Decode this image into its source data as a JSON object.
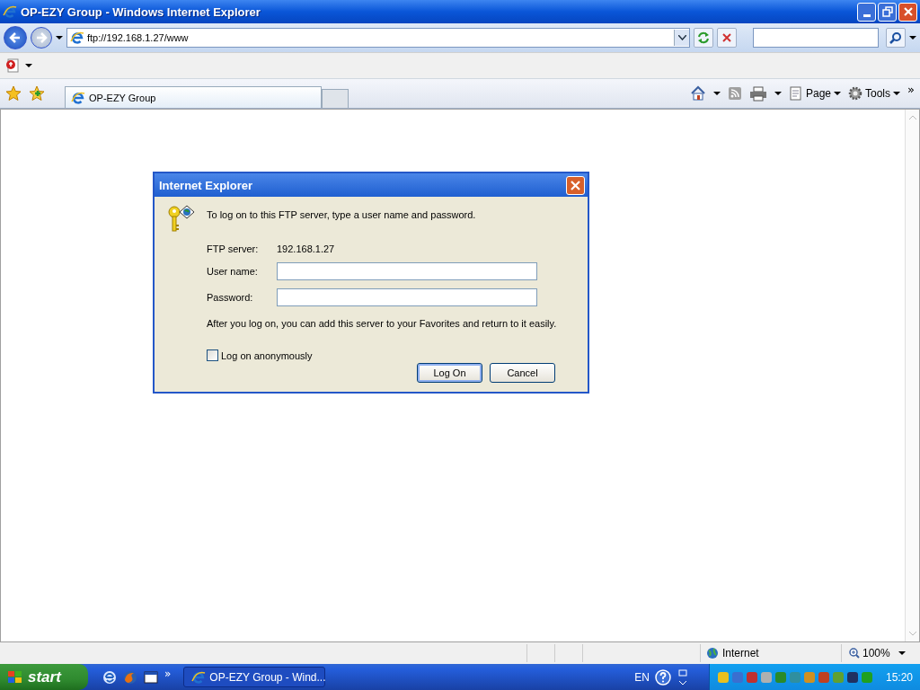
{
  "window": {
    "title": "OP-EZY Group - Windows Internet Explorer"
  },
  "address_bar": {
    "url": "ftp://192.168.1.27/www"
  },
  "tab": {
    "title": "OP-EZY Group"
  },
  "command_bar": {
    "page": "Page",
    "tools": "Tools",
    "overflow": "»"
  },
  "dialog": {
    "title": "Internet Explorer",
    "message": "To log on to this FTP server, type a user name and password.",
    "server_label": "FTP server:",
    "server_value": "192.168.1.27",
    "fields": [
      {
        "label": "User name:"
      },
      {
        "label": "Password:"
      }
    ],
    "note": "After you log on, you can add this server to your Favorites and return to it easily.",
    "checkbox": {
      "label": "Log on anonymously",
      "checked": false
    },
    "buttons": [
      {
        "label": "Log On",
        "default": true
      },
      {
        "label": "Cancel",
        "default": false
      }
    ]
  },
  "status_bar": {
    "zone": "Internet",
    "zoom": "100%"
  },
  "taskbar": {
    "start": "start",
    "quick_launch_more": "»",
    "task": "OP-EZY Group - Wind...",
    "language": "EN",
    "clock": "15:20"
  }
}
